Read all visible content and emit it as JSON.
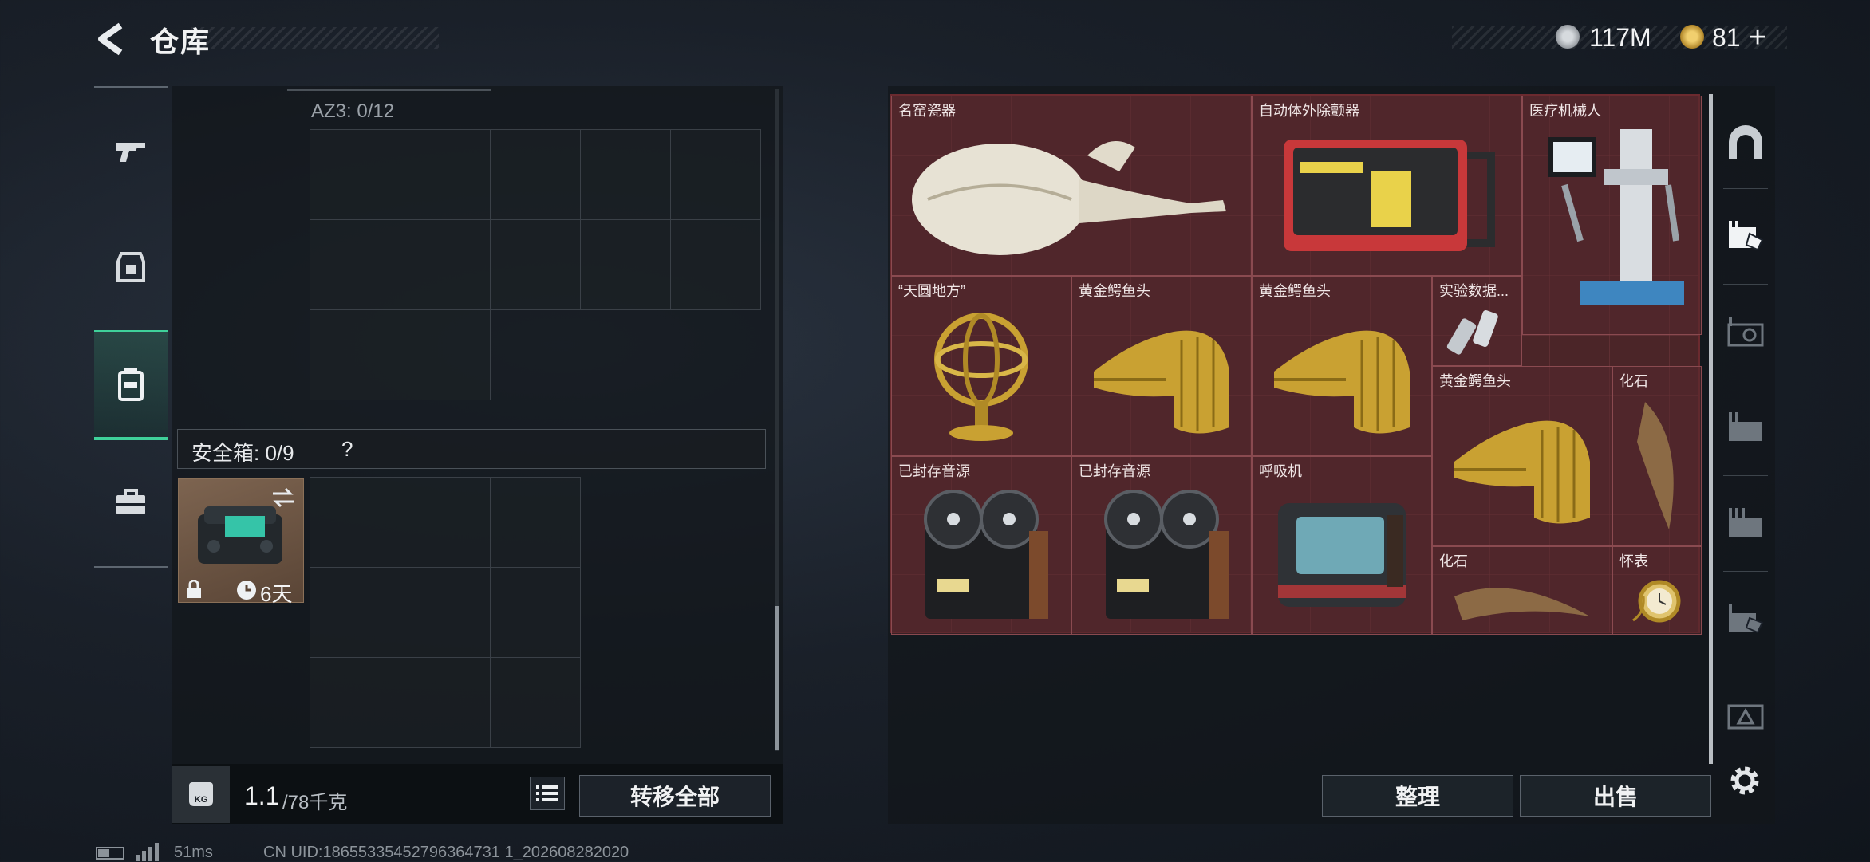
{
  "header": {
    "title": "仓库",
    "currency": [
      {
        "icon": "silver-coin-icon",
        "value": "117M"
      },
      {
        "icon": "gold-coin-icon",
        "value": "81"
      }
    ],
    "add_label": "+"
  },
  "left": {
    "container_label": "AZ3: 0/12",
    "safe_box_label": "安全箱: 0/9",
    "safe_help": "?",
    "safe_item_timer": "6天",
    "weight_value": "1.1",
    "weight_capacity": "/78千克",
    "weight_icon_label": "KG",
    "transfer_all_label": "转移全部"
  },
  "inventory": {
    "items": [
      {
        "name": "名窑瓷器"
      },
      {
        "name": "自动体外除颤器"
      },
      {
        "name": "医疗机械人"
      },
      {
        "name": "“天圆地方”"
      },
      {
        "name": "黄金鳄鱼头"
      },
      {
        "name": "黄金鳄鱼头"
      },
      {
        "name": "实验数据..."
      },
      {
        "name": "黄金鳄鱼头"
      },
      {
        "name": "化石"
      },
      {
        "name": "已封存音源"
      },
      {
        "name": "已封存音源"
      },
      {
        "name": "呼吸机"
      },
      {
        "name": "化石"
      },
      {
        "name": "怀表"
      }
    ],
    "sort_label": "整理",
    "sell_label": "出售"
  },
  "footer": {
    "ping": "51ms",
    "uid": "CN UID:18655335452796364731 1_202608282020"
  },
  "colors": {
    "accent_green": "#3fd19a",
    "grid_red": "#4b2528",
    "gold": "#c9a132"
  }
}
